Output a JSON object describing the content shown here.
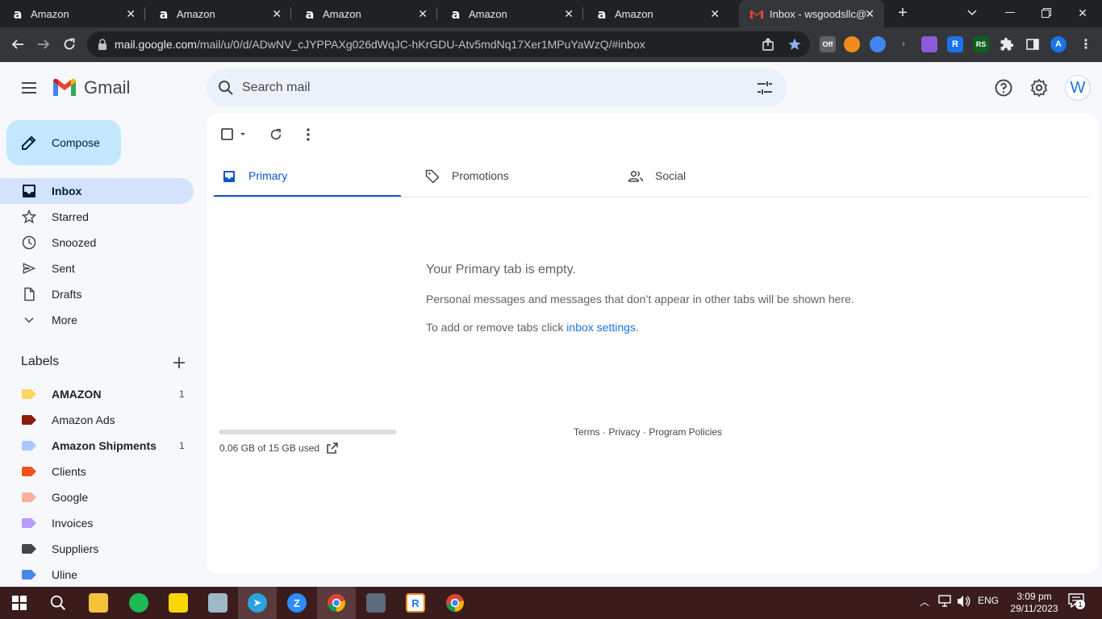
{
  "browser": {
    "tabs": [
      {
        "title": "Amazon",
        "favicon": "a"
      },
      {
        "title": "Amazon",
        "favicon": "a"
      },
      {
        "title": "Amazon",
        "favicon": "a"
      },
      {
        "title": "Amazon",
        "favicon": "a"
      },
      {
        "title": "Amazon",
        "favicon": "a"
      },
      {
        "title": "Inbox - wsgoodsllc@",
        "favicon": "gmail-icon"
      }
    ],
    "url_host": "mail.google.com",
    "url_path": "/mail/u/0/d/ADwNV_cJYPPAXg026dWqJC-hKrGDU-Atv5mdNq17Xer1MPuYaWzQ/#inbox",
    "extensions": [
      {
        "name": "off-toggle-extension",
        "text": "Off",
        "color": "#5f6368"
      },
      {
        "name": "orange-circle-extension",
        "text": "",
        "color": "#f28b1e"
      },
      {
        "name": "blue-puzzle-extension",
        "text": "",
        "color": "#4285f4"
      },
      {
        "name": "feather-extension",
        "text": "",
        "color": "#8e5bd6"
      },
      {
        "name": "r-extension",
        "text": "R",
        "color": "#1a73e8"
      },
      {
        "name": "rs-extension",
        "text": "RS",
        "color": "#0f5f1f"
      }
    ],
    "profile_letter": "A"
  },
  "gmail": {
    "brand": "Gmail",
    "search_placeholder": "Search mail",
    "avatar_letter": "W",
    "compose_label": "Compose",
    "nav": [
      {
        "label": "Inbox",
        "icon": "inbox-icon",
        "active": true
      },
      {
        "label": "Starred",
        "icon": "star-icon"
      },
      {
        "label": "Snoozed",
        "icon": "clock-icon"
      },
      {
        "label": "Sent",
        "icon": "send-icon"
      },
      {
        "label": "Drafts",
        "icon": "draft-icon"
      },
      {
        "label": "More",
        "icon": "chevron-down-icon"
      }
    ],
    "labels_title": "Labels",
    "labels": [
      {
        "label": "AMAZON",
        "color": "#fdd663",
        "count": "1",
        "bold": true
      },
      {
        "label": "Amazon Ads",
        "color": "#8a1c0a",
        "count": ""
      },
      {
        "label": "Amazon Shipments",
        "color": "#a8c7fa",
        "count": "1",
        "bold": true
      },
      {
        "label": "Clients",
        "color": "#f4511e",
        "count": ""
      },
      {
        "label": "Google",
        "color": "#f6b1a0",
        "count": ""
      },
      {
        "label": "Invoices",
        "color": "#b99aff",
        "count": ""
      },
      {
        "label": "Suppliers",
        "color": "#444746",
        "count": ""
      },
      {
        "label": "Uline",
        "color": "#4a86e8",
        "count": ""
      }
    ],
    "category_tabs": [
      {
        "label": "Primary",
        "icon": "inbox-icon",
        "active": true
      },
      {
        "label": "Promotions",
        "icon": "tag-icon"
      },
      {
        "label": "Social",
        "icon": "people-icon"
      }
    ],
    "empty": {
      "title": "Your Primary tab is empty.",
      "description": "Personal messages and messages that don’t appear in other tabs will be shown here.",
      "hint_prefix": "To add or remove tabs click ",
      "hint_link": "inbox settings",
      "hint_suffix": "."
    },
    "storage": {
      "text": "0.06 GB of 15 GB used",
      "fraction": 0.004
    },
    "footer": "Terms · Privacy · Program Policies"
  },
  "taskbar": {
    "language": "ENG",
    "time": "3:09 pm",
    "date": "29/11/2023",
    "notification_count": "1"
  }
}
